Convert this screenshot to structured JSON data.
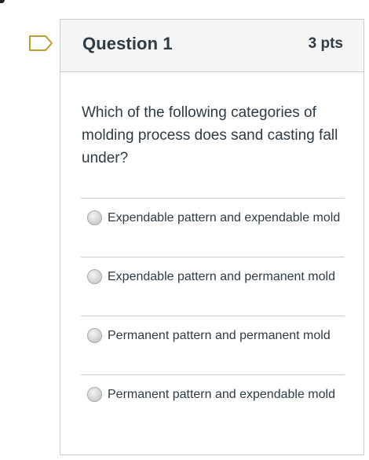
{
  "question": {
    "title": "Question 1",
    "points": "3 pts",
    "text": "Which of the following categories of molding process does sand casting fall under?",
    "bookmark_icon": "bookmark-flag-icon"
  },
  "answers": [
    {
      "label": "Expendable pattern and expendable mold",
      "selected": false
    },
    {
      "label": "Expendable pattern and permanent mold",
      "selected": false
    },
    {
      "label": "Permanent pattern and permanent mold",
      "selected": false
    },
    {
      "label": "Permanent pattern and expendable mold",
      "selected": false
    }
  ],
  "colors": {
    "text": "#2d3b45",
    "header_bg": "#f5f5f5",
    "border": "#c7cdd1",
    "bookmark_stroke": "#bd9d2e"
  }
}
